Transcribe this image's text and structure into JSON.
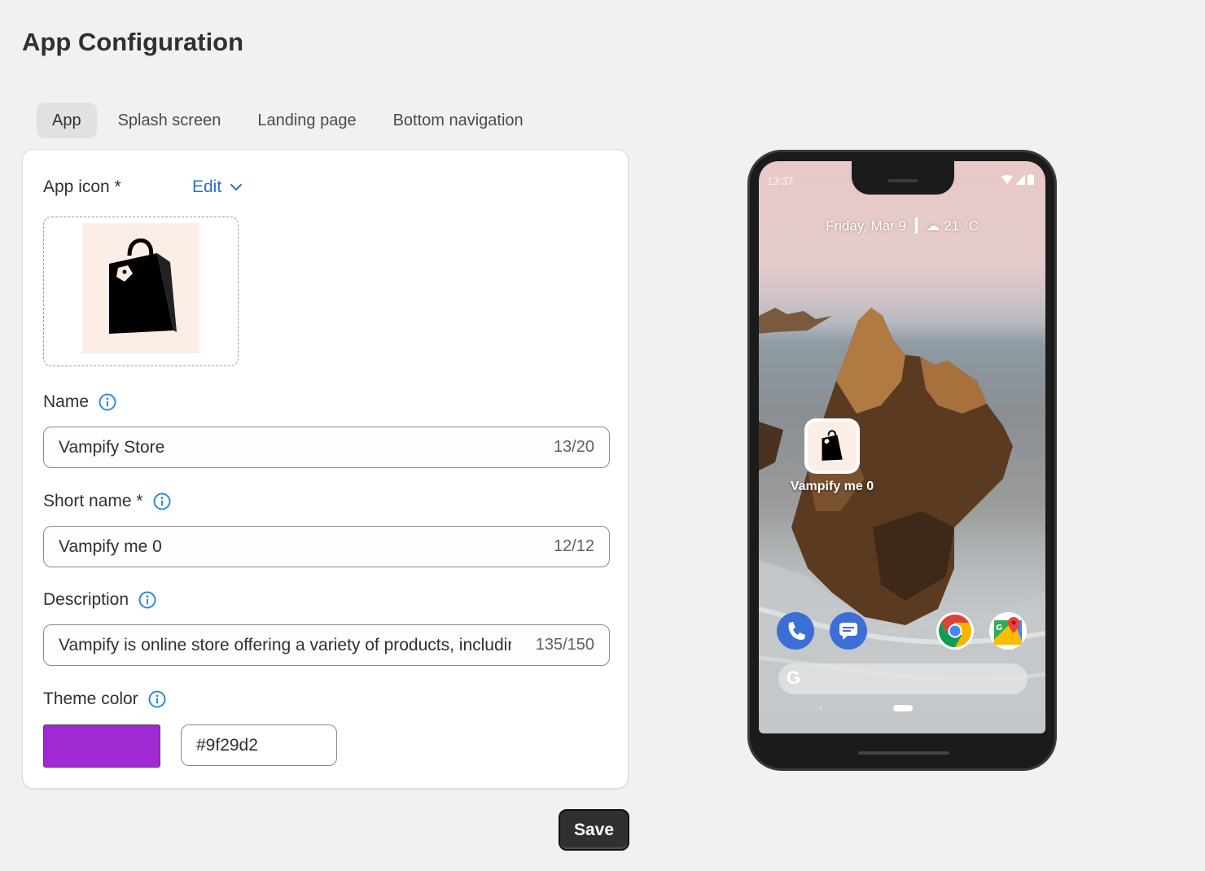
{
  "page": {
    "title": "App Configuration"
  },
  "tabs": [
    {
      "label": "App",
      "active": true
    },
    {
      "label": "Splash screen",
      "active": false
    },
    {
      "label": "Landing page",
      "active": false
    },
    {
      "label": "Bottom navigation",
      "active": false
    }
  ],
  "form": {
    "app_icon": {
      "label": "App icon *",
      "edit_label": "Edit"
    },
    "name": {
      "label": "Name",
      "value": "Vampify Store",
      "counter": "13/20"
    },
    "short_name": {
      "label": "Short name *",
      "value": "Vampify me 0",
      "counter": "12/12"
    },
    "description": {
      "label": "Description",
      "value": "Vampify is online store offering a variety of products, including fashion, electronics, home goods and more",
      "counter": "135/150"
    },
    "theme_color": {
      "label": "Theme color",
      "value": "#9f29d2"
    }
  },
  "save_label": "Save",
  "preview": {
    "time": "13:37",
    "date": "Friday, Mar 9",
    "temperature": "21 °C",
    "app_label": "Vampify me 0",
    "search_glyph": "G",
    "back_glyph": "‹"
  },
  "colors": {
    "accent_link": "#2c6ecb",
    "theme": "#9f29d2",
    "save_bg": "#303030"
  }
}
